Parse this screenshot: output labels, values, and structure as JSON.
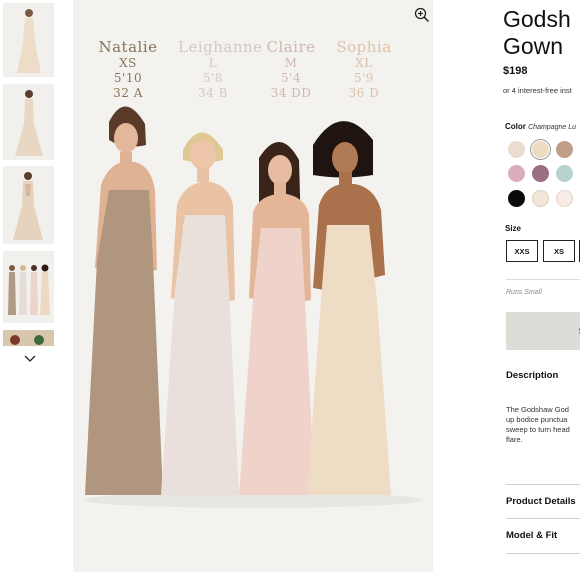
{
  "thumbnails": [
    {
      "name": "thumb-1",
      "alt": "single model front"
    },
    {
      "name": "thumb-2",
      "alt": "single model side"
    },
    {
      "name": "thumb-3",
      "alt": "single model back"
    },
    {
      "name": "thumb-4",
      "alt": "group of models"
    },
    {
      "name": "thumb-5",
      "alt": "partial thumbnail"
    }
  ],
  "size_chart": [
    {
      "name": "Natalie",
      "size": "XS",
      "height": "5'10",
      "bust": "32 A"
    },
    {
      "name": "Leighanne",
      "size": "L",
      "height": "5'8",
      "bust": "34 B"
    },
    {
      "name": "Claire",
      "size": "M",
      "height": "5'4",
      "bust": "34 DD"
    },
    {
      "name": "Sophia",
      "size": "XL",
      "height": "5'9",
      "bust": "36 D"
    }
  ],
  "product": {
    "title": "Godsh\nGown",
    "price": "$198",
    "installments": "or 4 interest-free inst",
    "color_label": "Color",
    "color_value": "Champagne Lu",
    "swatches": [
      "#e9ddd0",
      "#ecdcc4",
      "#bf9f89",
      "#d9adbc",
      "#9a6f83",
      "#b7d3cf",
      "#0a0a0a",
      "#f2e6d8",
      "#f6ebe5"
    ],
    "size_label": "Size",
    "sizes": [
      "XXS",
      "XS"
    ],
    "runs_note": "Runs Small",
    "add_button": "S",
    "description_heading": "Description",
    "description_lines": [
      "The Godshaw God",
      "up bodice punctua",
      "sweep to turn head",
      "flare."
    ],
    "details_heading": "Product Details",
    "model_fit_heading": "Model & Fit"
  }
}
